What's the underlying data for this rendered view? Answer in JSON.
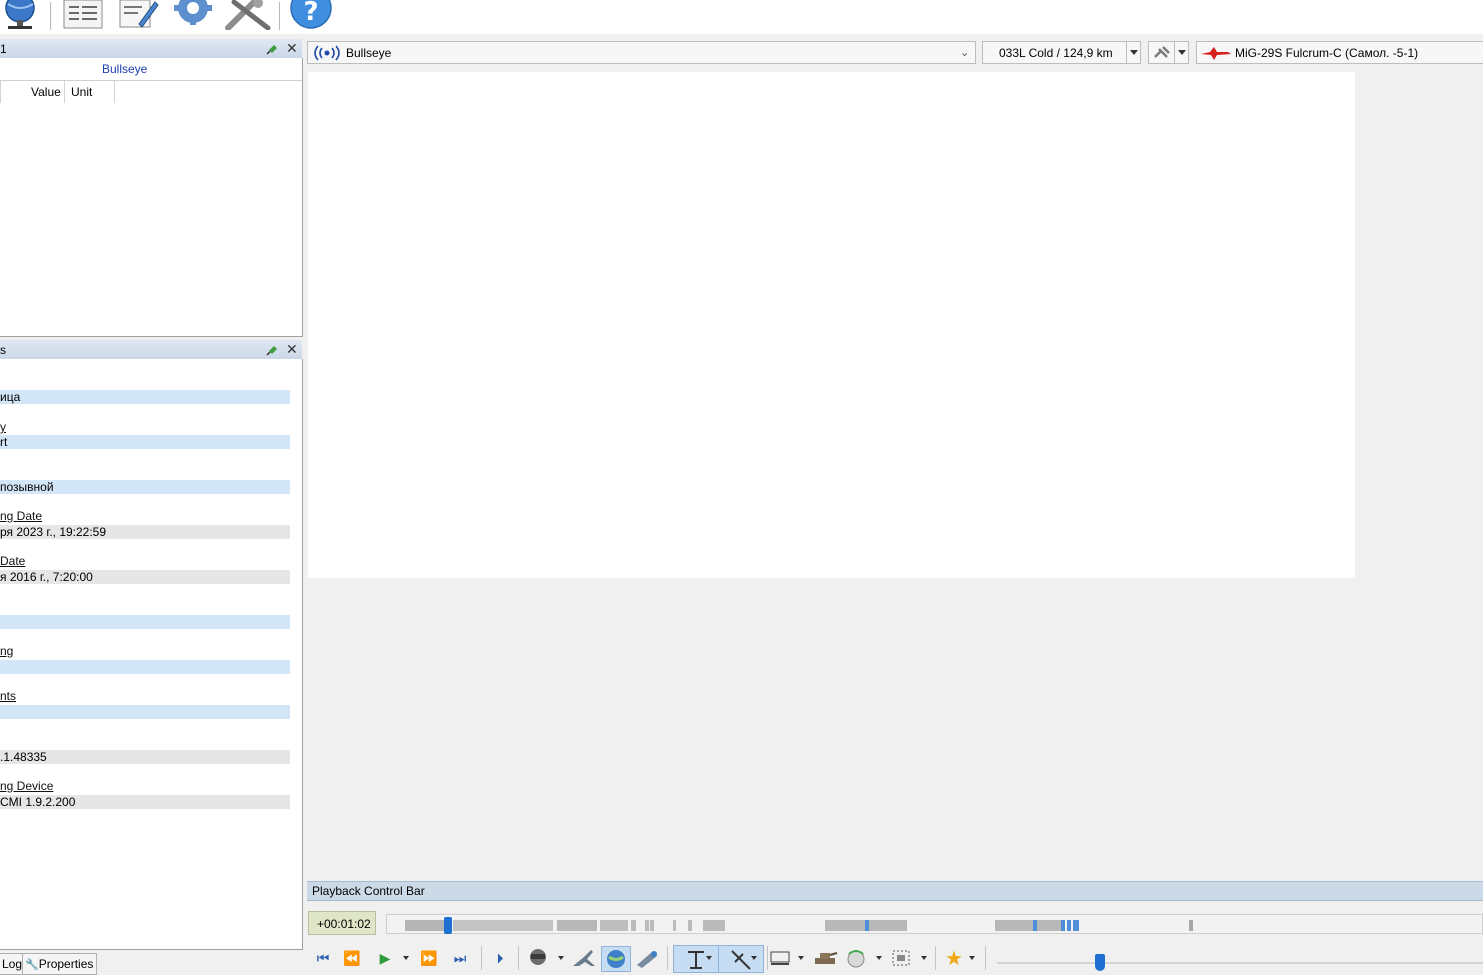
{
  "left_panel_top": {
    "title_fragment": "1",
    "bullseye_label": "Bullseye",
    "columns": [
      "Value",
      "Unit"
    ]
  },
  "left_panel_props": {
    "title_fragment": "s",
    "rows": [
      {
        "name": "",
        "value": "ица",
        "style": "blue"
      },
      {
        "name": "y",
        "value": "rt",
        "style": "blue"
      },
      {
        "name": "",
        "value": "позывной",
        "style": "blue"
      },
      {
        "name": "ng Date",
        "value": "ря 2023 г., 19:22:59",
        "style": "gray"
      },
      {
        "name": "Date",
        "value": "я 2016 г., 7:20:00",
        "style": "gray"
      },
      {
        "name": "",
        "value": "",
        "style": "blue"
      },
      {
        "name": "ng",
        "value": "",
        "style": "blue"
      },
      {
        "name": "nts",
        "value": "",
        "style": "blue"
      },
      {
        "name": "",
        "value": ".1.48335",
        "style": "gray"
      },
      {
        "name": "ng Device",
        "value": "CMI 1.9.2.200",
        "style": "gray"
      }
    ]
  },
  "bottom_tabs": [
    "Log",
    "Properties"
  ],
  "header": {
    "mode_label": "Bullseye",
    "target_label": "033L Cold / 124,9 km",
    "aircraft_label": "MiG-29S Fulcrum-C (Самол. -5-1)"
  },
  "playback": {
    "title": "Playback Control Bar",
    "time": "+00:01:02"
  },
  "colors": {
    "accent": "#1e6fd1",
    "panel_header": "#c9d6e6",
    "row_blue": "#d3e6f7",
    "row_gray": "#e6e6e6",
    "time_box": "#dfe5c7"
  },
  "icons": {
    "toolbar": [
      "globe-network-icon",
      "document-list-icon",
      "edit-notes-icon",
      "gear-icon",
      "tools-icon",
      "help-icon"
    ],
    "playback": [
      "skip-start-icon",
      "rewind-icon",
      "play-icon",
      "fast-forward-icon",
      "skip-end-icon",
      "step-icon",
      "pilot-view-icon",
      "jet-icon",
      "globe-icon",
      "binoculars-icon",
      "tactical-view-icon",
      "measure-icon",
      "layers-icon",
      "tank-icon",
      "radar-icon",
      "select-frame-icon",
      "favorite-star-icon"
    ]
  }
}
